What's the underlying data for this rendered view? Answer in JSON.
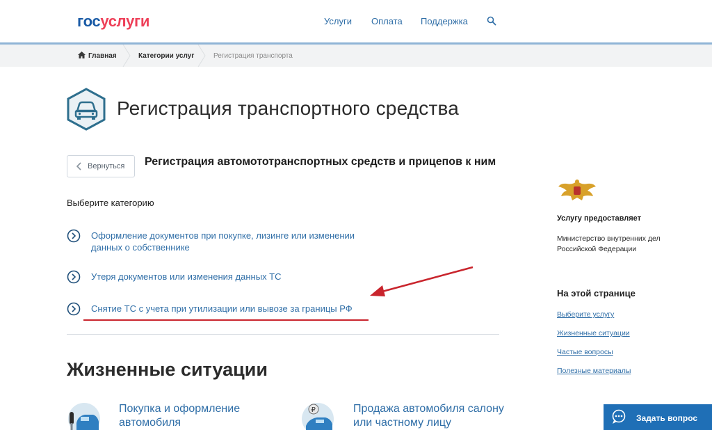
{
  "header": {
    "logo_part1": "гос",
    "logo_part2": "услуги",
    "nav": [
      "Услуги",
      "Оплата",
      "Поддержка"
    ]
  },
  "breadcrumb": {
    "home": "Главная",
    "categories": "Категории услуг",
    "current": "Регистрация транспорта"
  },
  "page": {
    "title": "Регистрация транспортного средства",
    "back_label": "Вернуться",
    "subtitle": "Регистрация автомототранспортных средств и прицепов к ним",
    "choose_label": "Выберите категорию",
    "categories": [
      "Оформление документов при покупке, лизинге или изменении данных о собственнике",
      "Утеря документов или изменения данных ТС",
      "Снятие ТС с учета при утилизации или вывозе за границы РФ"
    ],
    "life_situations_title": "Жизненные ситуации",
    "situations": [
      "Покупка и оформление автомобиля",
      "Продажа автомобиля салону или частному лицу"
    ]
  },
  "sidebar": {
    "provider_label": "Услугу предоставляет",
    "provider_name": "Министерство внутренних дел Российской Федерации",
    "on_page_label": "На этой странице",
    "toc": [
      "Выберите услугу",
      "Жизненные ситуации",
      "Частые вопросы",
      "Полезные материалы"
    ]
  },
  "ask_button": "Задать вопрос",
  "colors": {
    "brand_blue": "#1a5ba6",
    "brand_red": "#ee3f58",
    "link": "#2f6ea7",
    "annotation_red": "#c9252d",
    "icon_teal": "#2e6f8e"
  },
  "icons": [
    "search-icon",
    "home-icon",
    "car-icon",
    "chevron-left-icon",
    "chevron-right-circle-icon",
    "emblem-icon",
    "chat-icon"
  ]
}
